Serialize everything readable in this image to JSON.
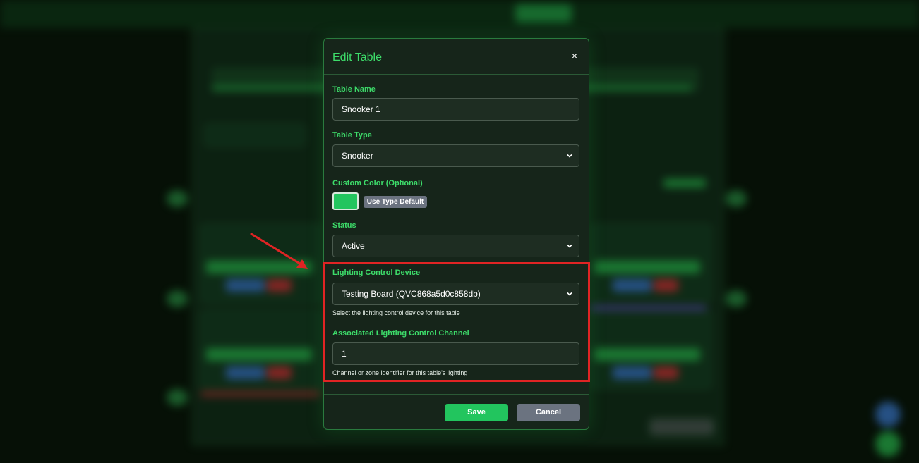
{
  "modal": {
    "title": "Edit Table",
    "close_label": "×",
    "fields": {
      "table_name": {
        "label": "Table Name",
        "value": "Snooker 1"
      },
      "table_type": {
        "label": "Table Type",
        "value": "Snooker"
      },
      "custom_color": {
        "label": "Custom Color (Optional)",
        "default_button": "Use Type Default",
        "value_color": "#22c55e"
      },
      "status": {
        "label": "Status",
        "value": "Active"
      },
      "lighting_device": {
        "label": "Lighting Control Device",
        "value": "Testing Board (QVC868a5d0c858db)",
        "hint": "Select the lighting control device for this table"
      },
      "lighting_channel": {
        "label": "Associated Lighting Control Channel",
        "value": "1",
        "hint": "Channel or zone identifier for this table's lighting"
      }
    },
    "buttons": {
      "save": "Save",
      "cancel": "Cancel"
    }
  },
  "colors": {
    "accent_green": "#3ddc6a",
    "save_green": "#22c55e",
    "cancel_gray": "#6b7380",
    "highlight_red": "#e02424"
  },
  "icons": {
    "close": "close-icon",
    "chevron": "chevron-down-icon",
    "annotation_arrow": "arrow-icon"
  }
}
